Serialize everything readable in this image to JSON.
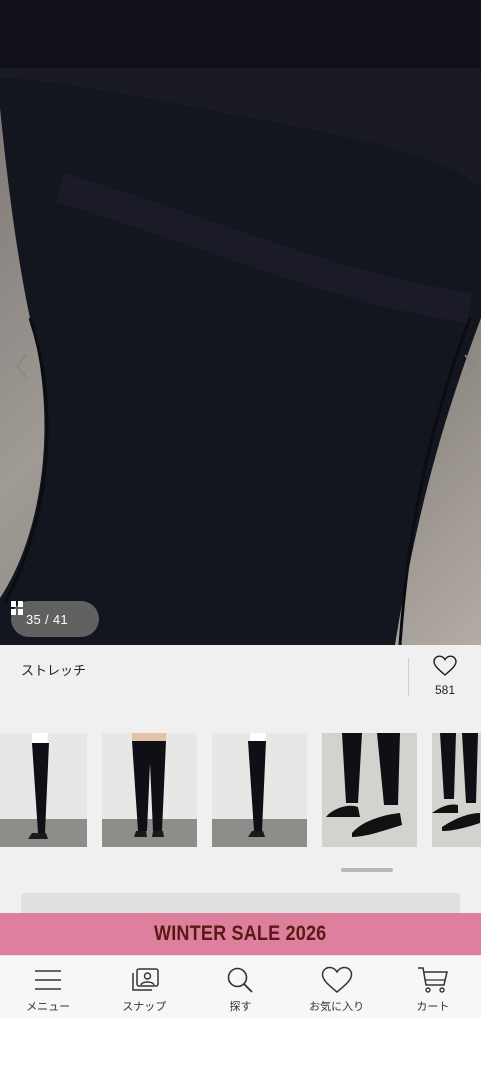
{
  "gallery": {
    "current": "35",
    "total": "41",
    "separator": "/",
    "grid_icon": "grid-icon",
    "prev_icon": "chevron-left-icon",
    "next_icon": "chevron-right-icon"
  },
  "product": {
    "tag": "ストレッチ",
    "favorite_count": "581",
    "favorite_icon": "heart-icon"
  },
  "thumbnails": [
    {
      "name": "side-view"
    },
    {
      "name": "back-view"
    },
    {
      "name": "side-view-2"
    },
    {
      "name": "hem-closeup"
    },
    {
      "name": "hem-closeup-2"
    }
  ],
  "banner": {
    "text": "WINTER SALE 2026",
    "background": "#df7f9e",
    "text_color": "#5a1a14"
  },
  "nav": {
    "items": [
      {
        "label": "メニュー",
        "icon": "menu-icon"
      },
      {
        "label": "スナップ",
        "icon": "snap-icon"
      },
      {
        "label": "探す",
        "icon": "search-icon"
      },
      {
        "label": "お気に入り",
        "icon": "heart-icon"
      },
      {
        "label": "カート",
        "icon": "cart-icon"
      }
    ]
  },
  "colors": {
    "top_bar": "#10111a",
    "info_bg": "#f0f0f0",
    "fabric": "#14161f"
  }
}
